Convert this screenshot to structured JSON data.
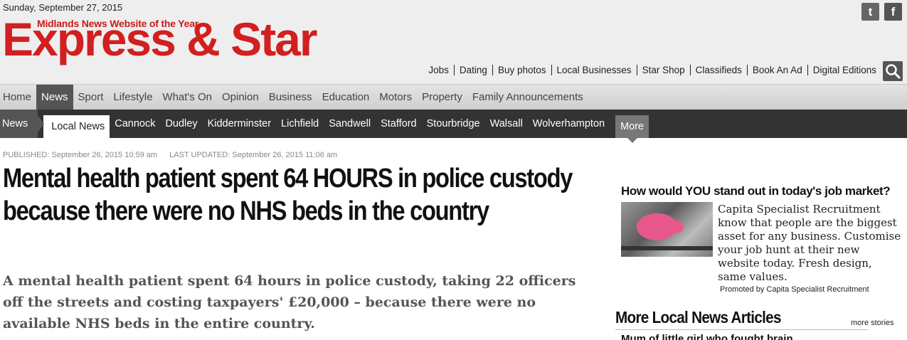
{
  "masthead": {
    "date": "Sunday, September 27, 2015",
    "tagline": "Midlands News Website of the Year",
    "logo": "Express & Star",
    "brand_color": "#d21f1f",
    "social": [
      {
        "label": "t",
        "icon": "twitter-icon"
      },
      {
        "label": "f",
        "icon": "facebook-icon"
      }
    ],
    "toplinks": [
      "Jobs",
      "Dating",
      "Buy photos",
      "Local Businesses",
      "Star Shop",
      "Classifieds",
      "Book An Ad",
      "Digital Editions"
    ]
  },
  "nav_primary": {
    "items": [
      "Home",
      "News",
      "Sport",
      "Lifestyle",
      "What's On",
      "Opinion",
      "Business",
      "Education",
      "Motors",
      "Property",
      "Family Announcements"
    ],
    "active": "News"
  },
  "nav_secondary": {
    "crumb": "News",
    "items": [
      "Local News",
      "Cannock",
      "Dudley",
      "Kidderminster",
      "Lichfield",
      "Sandwell",
      "Stafford",
      "Stourbridge",
      "Walsall",
      "Wolverhampton"
    ],
    "current": "Local News",
    "more": "More"
  },
  "article": {
    "published": "PUBLISHED: September 26, 2015 10:59 am",
    "updated": "LAST UPDATED: September 26, 2015 11:06 am",
    "headline": "Mental health patient spent 64 HOURS in police custody because there were no NHS beds in the country",
    "standfirst": "A mental health patient spent 64 hours in police custody, taking 22 officers off the streets and costing taxpayers' £20,000 – because there were no available NHS beds in the entire country."
  },
  "promo": {
    "title": "How would YOU stand out in today's job market?",
    "text": "Capita Specialist Recruitment know that people are the biggest asset for any business. Customise your job hunt at their new website today. Fresh design, same values.",
    "promoted_by": "Promoted by Capita Specialist Recruitment"
  },
  "more_local": {
    "title": "More Local News Articles",
    "more_link": "more stories",
    "first_headline": "Mum of little girl who fought brain ..."
  }
}
